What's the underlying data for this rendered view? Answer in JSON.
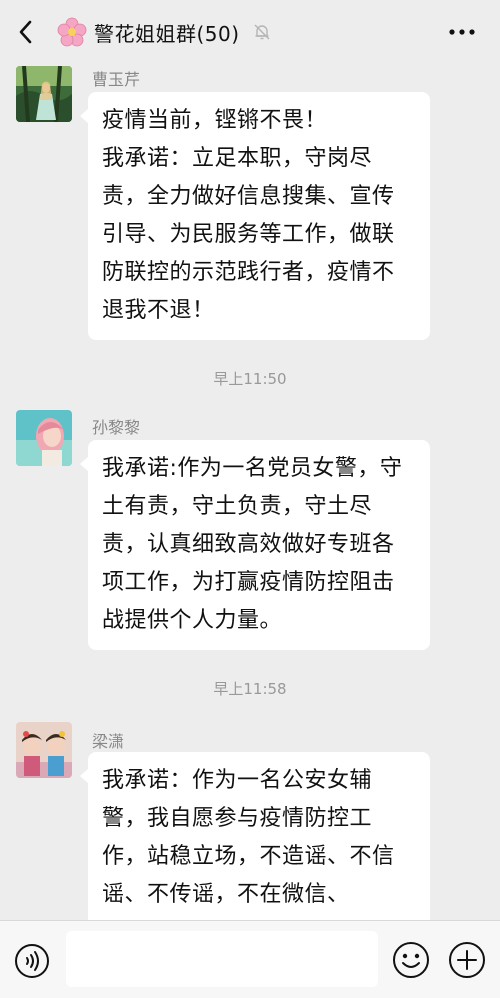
{
  "header": {
    "title": "警花姐姐群(50)",
    "icons": [
      "back-chevron-icon",
      "cherry-blossom-icon",
      "mute-bell-icon",
      "more-dots-icon"
    ]
  },
  "messages": [
    {
      "sender": "曹玉芹",
      "text": "疫情当前，铿锵不畏！\n我承诺：立足本职，守岗尽责，全力做好信息搜集、宣传引导、为民服务等工作，做联防联控的示范践行者，疫情不退我不退！"
    },
    {
      "time": "早上11:50",
      "sender": "孙黎黎",
      "text": "我承诺:作为一名党员女警，守土有责，守土负责，守土尽责，认真细致高效做好专班各项工作，为打赢疫情防控阻击战提供个人力量。"
    },
    {
      "time": "早上11:58",
      "sender": "梁潇",
      "text": "我承诺：作为一名公安女辅警，我自愿参与疫情防控工作，站稳立场，不造谣、不信谣、不传谣，不在微信、"
    }
  ],
  "footer": {
    "input_value": "",
    "icons": [
      "voice-icon",
      "emoji-icon",
      "plus-icon"
    ]
  }
}
